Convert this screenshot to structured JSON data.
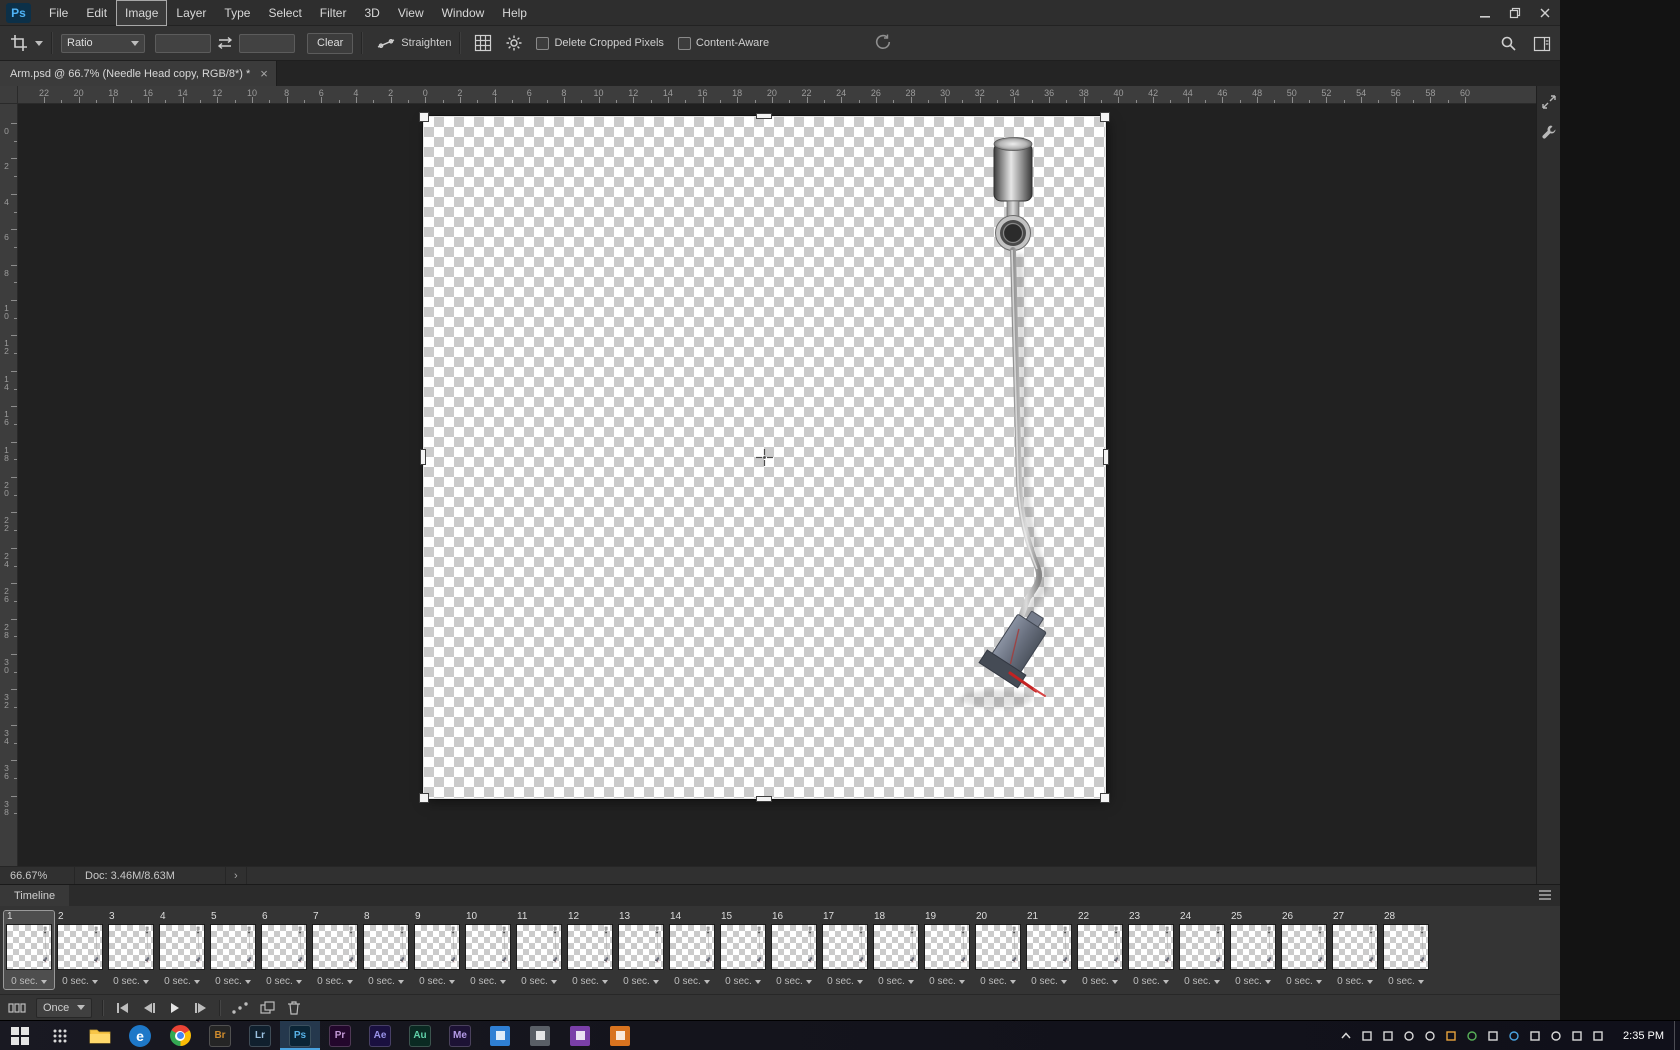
{
  "app": {
    "logo": "Ps"
  },
  "menubar": {
    "items": [
      "File",
      "Edit",
      "Image",
      "Layer",
      "Type",
      "Select",
      "Filter",
      "3D",
      "View",
      "Window",
      "Help"
    ],
    "highlighted": "Image"
  },
  "window_icons": [
    "minimize-icon",
    "restore-icon",
    "close-icon"
  ],
  "options_bar": {
    "tool_icon": "crop-icon",
    "ratio_value": "Ratio",
    "width_value": "",
    "height_value": "",
    "swap_icon": "swap-arrows-icon",
    "clear_label": "Clear",
    "straighten_icon": "straighten-icon",
    "straighten_label": "Straighten",
    "overlay_icon": "grid-overlay-icon",
    "settings_icon": "gear-icon",
    "checkbox_delete": {
      "label": "Delete Cropped Pixels",
      "checked": false
    },
    "checkbox_content": {
      "label": "Content-Aware",
      "checked": false
    },
    "reset_icon": "reset-icon",
    "search_icon": "search-icon",
    "workspace_icon": "workspace-icon"
  },
  "document_tab": {
    "title": "Arm.psd @ 66.7% (Needle Head copy, RGB/8*) *",
    "close_glyph": "×"
  },
  "rulers": {
    "horizontal": [
      "22",
      "20",
      "18",
      "16",
      "14",
      "12",
      "10",
      "8",
      "6",
      "4",
      "2",
      "0",
      "2",
      "4",
      "6",
      "8",
      "10",
      "12",
      "14",
      "16",
      "18",
      "20",
      "22",
      "24",
      "26",
      "28",
      "30",
      "32",
      "34",
      "36",
      "38",
      "40",
      "42",
      "44",
      "46",
      "48",
      "50",
      "52",
      "54",
      "56",
      "58",
      "60"
    ],
    "vertical": [
      "0",
      "2",
      "4",
      "6",
      "8",
      "10",
      "12",
      "14",
      "16",
      "18",
      "20",
      "22",
      "24",
      "26",
      "28",
      "30",
      "32",
      "34",
      "36",
      "38"
    ]
  },
  "status_bar": {
    "zoom": "66.67%",
    "doc_info": "Doc: 3.46M/8.63M",
    "expand_glyph": "›"
  },
  "right_dock": {
    "icons": [
      "collapsed-panel-arrows-icon",
      "collapsed-panel-wrench-icon"
    ]
  },
  "timeline": {
    "tab_label": "Timeline",
    "menu_icon": "panel-menu-icon",
    "loop_option": "Once",
    "selected_frame": 1,
    "frame_delay": "0 sec.",
    "frame_numbers": [
      "1",
      "2",
      "3",
      "4",
      "5",
      "6",
      "7",
      "8",
      "9",
      "10",
      "11",
      "12",
      "13",
      "14",
      "15",
      "16",
      "17",
      "18",
      "19",
      "20",
      "21",
      "22",
      "23",
      "24",
      "25",
      "26",
      "27",
      "28"
    ]
  },
  "timeline_controls": {
    "icons": [
      "convert-timeline-icon",
      "first-frame-icon",
      "previous-frame-icon",
      "play-icon",
      "next-frame-icon",
      "tween-icon",
      "duplicate-frame-icon",
      "delete-frame-icon"
    ]
  },
  "taskbar": {
    "time": "2:35 PM",
    "apps": [
      {
        "name": "start-button",
        "kind": "start"
      },
      {
        "name": "app-grid",
        "kind": "tiles"
      },
      {
        "name": "file-explorer",
        "kind": "folder"
      },
      {
        "name": "browser-ie",
        "kind": "circle",
        "bg": "#1e78c8",
        "glyph": "e"
      },
      {
        "name": "browser-chrome",
        "kind": "chrome"
      },
      {
        "name": "adobe-bridge",
        "kind": "tile",
        "label": "Br",
        "bg": "#252525",
        "fg": "#cf8b2d"
      },
      {
        "name": "adobe-lightroom",
        "kind": "tile",
        "label": "Lr",
        "bg": "#10202e",
        "fg": "#9bc1e0"
      },
      {
        "name": "adobe-photoshop",
        "kind": "tile",
        "label": "Ps",
        "bg": "#0b2536",
        "fg": "#57b2e8",
        "active": true
      },
      {
        "name": "adobe-premiere",
        "kind": "tile",
        "label": "Pr",
        "bg": "#23072c",
        "fg": "#c39ad6"
      },
      {
        "name": "adobe-aftereffects",
        "kind": "tile",
        "label": "Ae",
        "bg": "#1a1040",
        "fg": "#9a93e8"
      },
      {
        "name": "adobe-audition",
        "kind": "tile",
        "label": "Au",
        "bg": "#0a2a22",
        "fg": "#5fd0a8"
      },
      {
        "name": "adobe-mediaencoder",
        "kind": "tile",
        "label": "Me",
        "bg": "#1d1235",
        "fg": "#b49ae6"
      },
      {
        "name": "app-blue",
        "kind": "square",
        "bg": "#2f7fd4"
      },
      {
        "name": "app-gray",
        "kind": "square",
        "bg": "#5a5f66"
      },
      {
        "name": "app-purple",
        "kind": "square",
        "bg": "#7a3fa8"
      },
      {
        "name": "app-orange",
        "kind": "square",
        "bg": "#d8731f"
      }
    ],
    "tray": [
      {
        "name": "chevron-up-icon",
        "shape": "chevron"
      },
      {
        "name": "app-window-icon",
        "shape": "square"
      },
      {
        "name": "display-icon",
        "shape": "square"
      },
      {
        "name": "shield-icon",
        "shape": "circle"
      },
      {
        "name": "cloud-icon",
        "shape": "circle"
      },
      {
        "name": "sync-icon",
        "shape": "square",
        "color": "#e8a33d"
      },
      {
        "name": "pen-icon",
        "shape": "circle",
        "color": "#58b058"
      },
      {
        "name": "usb-icon",
        "shape": "square"
      },
      {
        "name": "bluetooth-icon",
        "shape": "circle",
        "color": "#4aa3e0"
      },
      {
        "name": "network-icon",
        "shape": "square"
      },
      {
        "name": "volume-icon",
        "shape": "circle"
      },
      {
        "name": "battery-icon",
        "shape": "square"
      },
      {
        "name": "action-center-icon",
        "shape": "square"
      }
    ]
  }
}
